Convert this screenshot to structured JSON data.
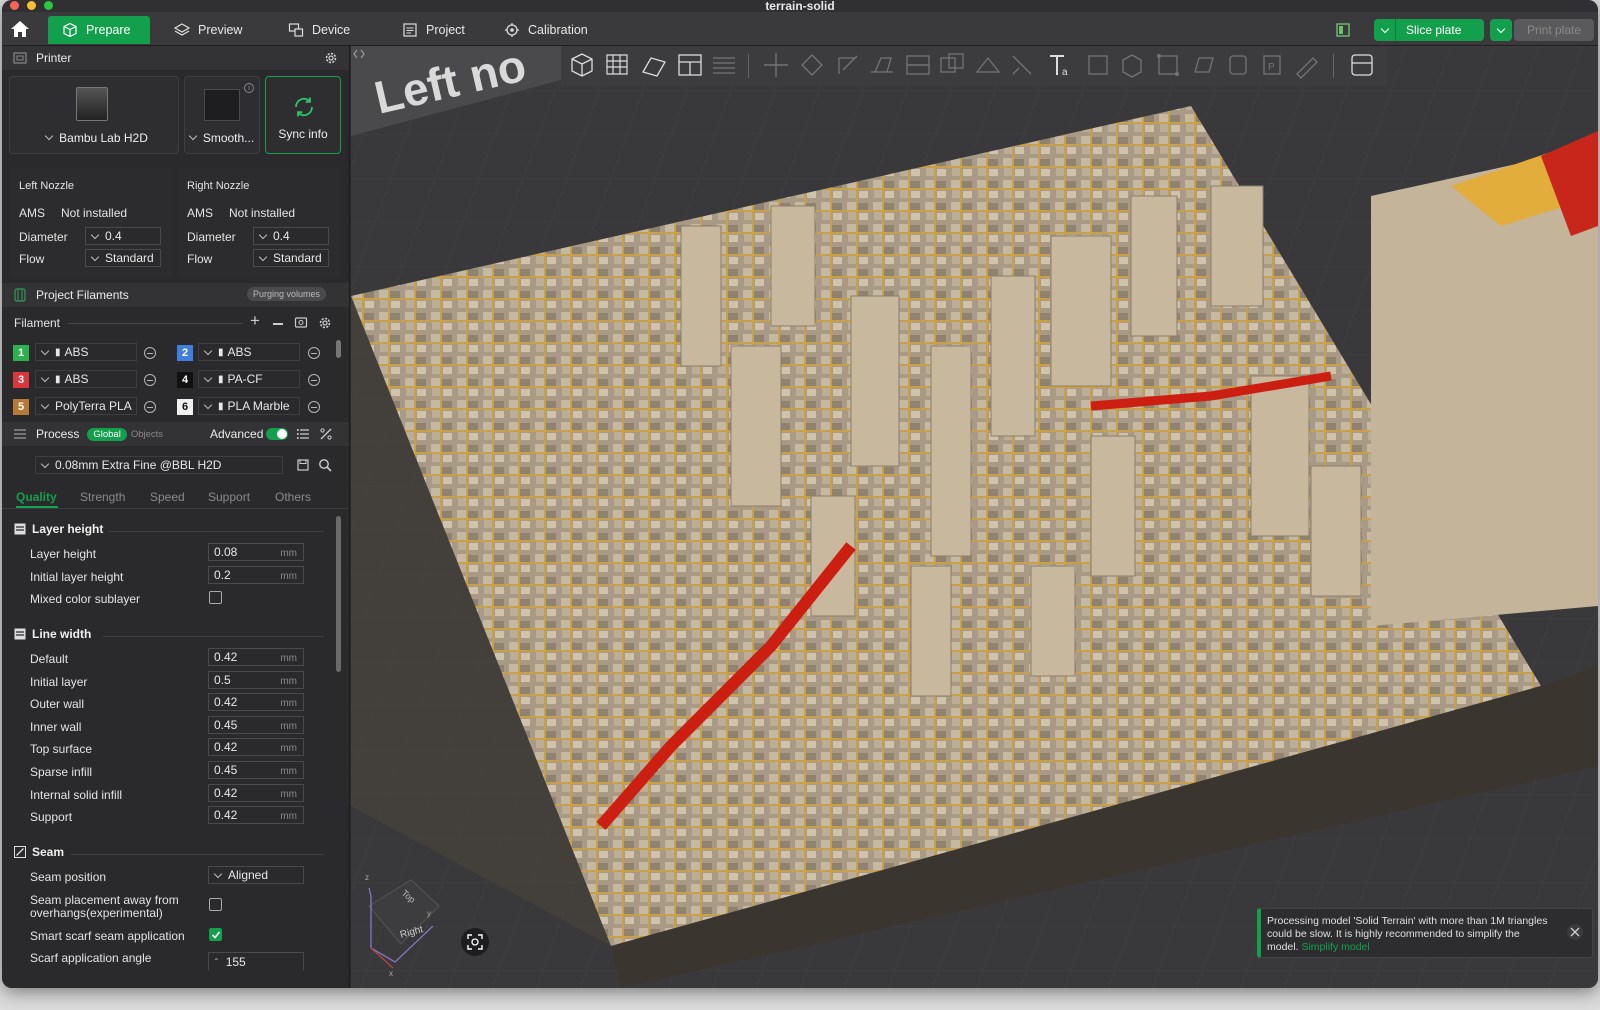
{
  "window": {
    "title": "terrain-solid"
  },
  "topbar": {
    "tabs": [
      {
        "label": "Prepare",
        "icon": "cube-icon",
        "active": true
      },
      {
        "label": "Preview",
        "icon": "layers-icon"
      },
      {
        "label": "Device",
        "icon": "device-icon"
      },
      {
        "label": "Project",
        "icon": "project-icon"
      },
      {
        "label": "Calibration",
        "icon": "calibration-icon"
      }
    ],
    "slice_label": "Slice plate",
    "print_label": "Print plate"
  },
  "printer": {
    "title": "Printer",
    "printer_name": "Bambu Lab H2D",
    "plate_name": "Smooth...",
    "sync_label": "Sync info",
    "left_nozzle": {
      "title": "Left Nozzle",
      "ams_label": "AMS",
      "ams_value": "Not installed",
      "diameter_label": "Diameter",
      "diameter_value": "0.4",
      "flow_label": "Flow",
      "flow_value": "Standard"
    },
    "right_nozzle": {
      "title": "Right Nozzle",
      "ams_label": "AMS",
      "ams_value": "Not installed",
      "diameter_label": "Diameter",
      "diameter_value": "0.4",
      "flow_label": "Flow",
      "flow_value": "Standard"
    }
  },
  "filaments": {
    "title": "Project Filaments",
    "purging_label": "Purging volumes",
    "filament_label": "Filament",
    "items": [
      {
        "num": "1",
        "name": "ABS",
        "color": "#2bb24c"
      },
      {
        "num": "2",
        "name": "ABS",
        "color": "#3f7fe0"
      },
      {
        "num": "3",
        "name": "ABS",
        "color": "#d9363e"
      },
      {
        "num": "4",
        "name": "PA-CF",
        "color": "#111111"
      },
      {
        "num": "5",
        "name": "PolyTerra PLA",
        "color": "#b77a36"
      },
      {
        "num": "6",
        "name": "PLA Marble",
        "color": "#f2f2f2"
      }
    ]
  },
  "process": {
    "title": "Process",
    "global_label": "Global",
    "objects_label": "Objects",
    "advanced_label": "Advanced",
    "preset": "0.08mm Extra Fine @BBL H2D",
    "tabs": [
      "Quality",
      "Strength",
      "Speed",
      "Support",
      "Others"
    ],
    "layer_height": {
      "title": "Layer height",
      "rows": [
        {
          "label": "Layer height",
          "value": "0.08",
          "unit": "mm"
        },
        {
          "label": "Initial layer height",
          "value": "0.2",
          "unit": "mm"
        }
      ],
      "mixed_label": "Mixed color sublayer"
    },
    "line_width": {
      "title": "Line width",
      "rows": [
        {
          "label": "Default",
          "value": "0.42",
          "unit": "mm"
        },
        {
          "label": "Initial layer",
          "value": "0.5",
          "unit": "mm"
        },
        {
          "label": "Outer wall",
          "value": "0.42",
          "unit": "mm"
        },
        {
          "label": "Inner wall",
          "value": "0.45",
          "unit": "mm"
        },
        {
          "label": "Top surface",
          "value": "0.42",
          "unit": "mm"
        },
        {
          "label": "Sparse infill",
          "value": "0.45",
          "unit": "mm"
        },
        {
          "label": "Internal solid infill",
          "value": "0.42",
          "unit": "mm"
        },
        {
          "label": "Support",
          "value": "0.42",
          "unit": "mm"
        }
      ]
    },
    "seam": {
      "title": "Seam",
      "position_label": "Seam position",
      "position_value": "Aligned",
      "away_label_1": "Seam placement away from",
      "away_label_2": "overhangs(experimental)",
      "scarf_label": "Smart scarf seam application",
      "angle_label": "Scarf application angle",
      "angle_value": "155"
    }
  },
  "viewport": {
    "plate_label": "Left no",
    "axis_top": "Top",
    "axis_right": "Right",
    "axis_z": "z",
    "axis_y": "y",
    "axis_x": "x",
    "toast_text": "Processing model 'Solid Terrain' with more than 1M triangles could be slow. It is highly recommended to simplify the model.",
    "toast_link": "Simplify model"
  }
}
